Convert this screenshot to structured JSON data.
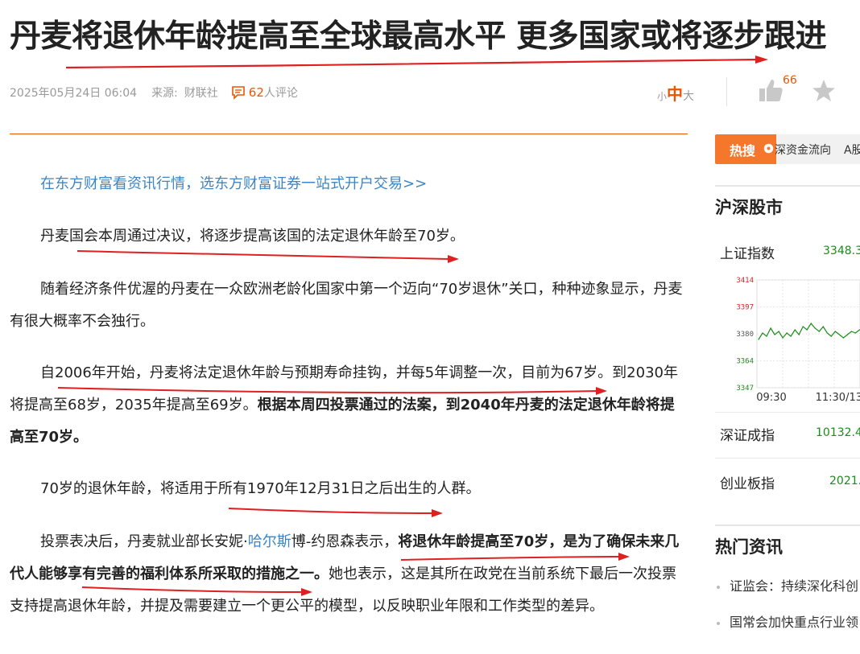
{
  "article": {
    "title": "丹麦将退休年龄提高至全球最高水平 更多国家或将逐步跟进",
    "date": "2025年05月24日 06:04",
    "source_label": "来源:",
    "source": "财联社",
    "comment_count": "62",
    "comment_suffix": "人评论",
    "promo_link": "在东方财富看资讯行情，选东方财富证券一站式开户交易>>",
    "paragraphs": {
      "p1": "丹麦国会本周通过决议，将逐步提高该国的法定退休年龄至70岁。",
      "p2": "随着经济条件优渥的丹麦在一众欧洲老龄化国家中第一个迈向“70岁退休”关口，种种迹象显示，丹麦有很大概率不会独行。",
      "p3_a": "自2006年开始，丹麦将法定退休年龄与预期寿命挂钩，并每5年调整一次，目前为67岁。到2030年将提高至68岁，2035年提高至69岁。",
      "p3_b": "根据本周四投票通过的法案，到2040年丹麦的法定退休年龄将提高至70岁。",
      "p4": "70岁的退休年龄，将适用于所有1970年12月31日之后出生的人群。",
      "p5_a": "投票表决后，丹麦就业部长安妮·",
      "p5_link": "哈尔斯",
      "p5_b": "博-约恩森表示，",
      "p5_c": "将退休年龄提高至70岁，是为了确保未来几代人能够享有完善的福利体系所采取的措施之一。",
      "p5_d": "她也表示，这是其所在政党在当前系统下最后一次投票支持提高退休年龄，并提及需要建立一个更公平的模型，以反映职业年限和工作类型的差异。"
    }
  },
  "toolbar": {
    "font_small": "小",
    "font_mid": "中",
    "font_large": "大",
    "like_count": "66",
    "like_icon": "thumbs-up-icon",
    "star_icon": "star-icon"
  },
  "sidebar": {
    "hot_search": {
      "label": "热搜",
      "items": [
        "深资金流向",
        "A股"
      ]
    },
    "market": {
      "heading": "沪深股市",
      "indices": [
        {
          "name": "上证指数",
          "value": "3348.3"
        },
        {
          "name": "深证成指",
          "value": "10132.4"
        },
        {
          "name": "创业板指",
          "value": "2021."
        }
      ]
    },
    "news": {
      "heading": "热门资讯",
      "items": [
        "证监会：持续深化科创",
        "国常会加快重点行业领"
      ]
    }
  },
  "chart_data": {
    "type": "line",
    "title": "",
    "y_ticks": [
      "3414",
      "3397",
      "3380",
      "3364",
      "3347"
    ],
    "x_ticks": [
      "09:30",
      "11:30/13:"
    ],
    "ylim": [
      3347,
      3414
    ],
    "series": [
      {
        "x": [
          "09:30",
          "09:36",
          "09:42",
          "09:48",
          "09:54",
          "10:00",
          "10:06",
          "10:12",
          "10:18",
          "10:24",
          "10:30",
          "10:36",
          "10:42",
          "10:48",
          "10:54",
          "11:00",
          "11:06",
          "11:12",
          "11:18",
          "11:24",
          "11:30",
          "13:06",
          "13:12",
          "13:18",
          "13:24",
          "13:30"
        ],
        "values": [
          3377,
          3381,
          3379,
          3384,
          3380,
          3382,
          3378,
          3381,
          3379,
          3383,
          3380,
          3385,
          3383,
          3387,
          3384,
          3382,
          3385,
          3381,
          3379,
          3382,
          3380,
          3378,
          3380,
          3382,
          3381,
          3383
        ],
        "color": "#1a8c1a"
      }
    ],
    "reference_value": 3380,
    "grid": true
  },
  "colors": {
    "accent": "#ea5504",
    "link": "#3f85c2",
    "up_green": "#1a8c1a",
    "annotation_red": "#e02020"
  }
}
